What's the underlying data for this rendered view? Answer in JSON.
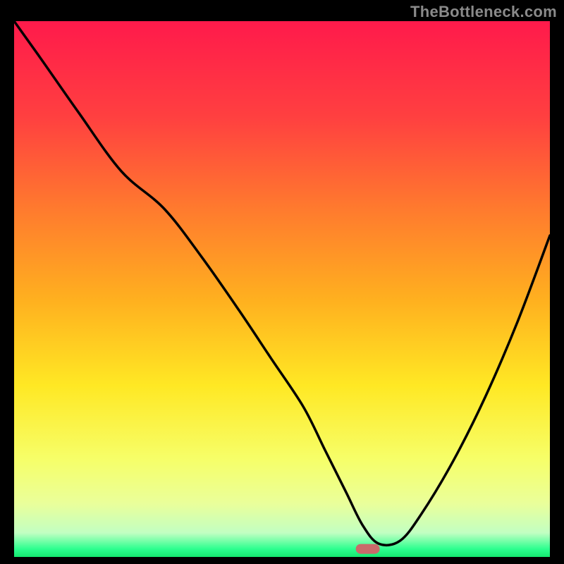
{
  "watermark": "TheBottleneck.com",
  "chart_data": {
    "type": "line",
    "title": "",
    "xlabel": "",
    "ylabel": "",
    "xlim": [
      0,
      100
    ],
    "ylim": [
      0,
      100
    ],
    "grid": false,
    "legend": false,
    "background_gradient": {
      "stops": [
        {
          "offset": 0.0,
          "color": "#ff1a4b"
        },
        {
          "offset": 0.18,
          "color": "#ff4040"
        },
        {
          "offset": 0.35,
          "color": "#ff7a2e"
        },
        {
          "offset": 0.52,
          "color": "#ffb01f"
        },
        {
          "offset": 0.68,
          "color": "#ffe824"
        },
        {
          "offset": 0.82,
          "color": "#f6ff6a"
        },
        {
          "offset": 0.9,
          "color": "#eaff9a"
        },
        {
          "offset": 0.955,
          "color": "#c2ffc2"
        },
        {
          "offset": 0.985,
          "color": "#2dff8f"
        },
        {
          "offset": 1.0,
          "color": "#14e86f"
        }
      ]
    },
    "marker": {
      "x": 66,
      "y": 1.5,
      "color": "#c96a6a",
      "shape": "pill"
    },
    "series": [
      {
        "name": "bottleneck-curve",
        "x": [
          0,
          5,
          12,
          20,
          28,
          35,
          42,
          48,
          54,
          58,
          62,
          65,
          68,
          72,
          76,
          82,
          88,
          94,
          100
        ],
        "y": [
          100,
          93,
          83,
          72,
          65,
          56,
          46,
          37,
          28,
          20,
          12,
          6,
          2.5,
          3,
          8,
          18,
          30,
          44,
          60
        ]
      }
    ],
    "notes": "y-values are approximate, read off the vertical position of the black curve against the 0–100 gradient; 0 = bottom (green), 100 = top (red). x = 0–100 left to right. Curve falls steeply from top-left to a minimum near x≈66, then rises toward the right edge."
  }
}
